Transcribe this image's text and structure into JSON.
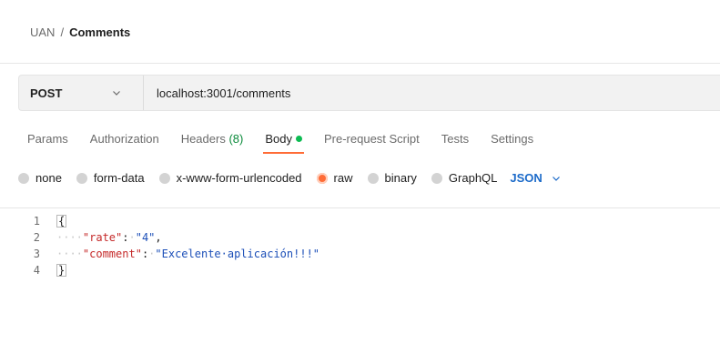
{
  "breadcrumb": {
    "root": "UAN",
    "separator": "/",
    "current": "Comments"
  },
  "request": {
    "method": "POST",
    "url": "localhost:3001/comments"
  },
  "tabs": [
    {
      "label": "Params"
    },
    {
      "label": "Authorization"
    },
    {
      "label": "Headers",
      "count": "(8)"
    },
    {
      "label": "Body",
      "active": true
    },
    {
      "label": "Pre-request Script"
    },
    {
      "label": "Tests"
    },
    {
      "label": "Settings"
    }
  ],
  "body_types": {
    "options": [
      "none",
      "form-data",
      "x-www-form-urlencoded",
      "raw",
      "binary",
      "GraphQL"
    ],
    "selected": "raw",
    "language": "JSON"
  },
  "editor": {
    "lines": [
      {
        "number": "1",
        "open": "{"
      },
      {
        "number": "2",
        "indent": "····",
        "key": "\"rate\"",
        "colon": ":",
        "sep": "·",
        "value": "\"4\"",
        "comma": ","
      },
      {
        "number": "3",
        "indent": "····",
        "key": "\"comment\"",
        "colon": ":",
        "sep": "·",
        "value": "\"Excelente·aplicación!!!\""
      },
      {
        "number": "4",
        "close": "}"
      }
    ]
  },
  "colors": {
    "accent": "#ff6c37",
    "status_dot": "#0cbb52",
    "link_blue": "#1b6ac9",
    "json_key": "#c52a2a",
    "json_string": "#1c4fb8"
  },
  "icons": {
    "method_dropdown": "chevron-down-icon",
    "language_dropdown": "chevron-down-icon"
  }
}
